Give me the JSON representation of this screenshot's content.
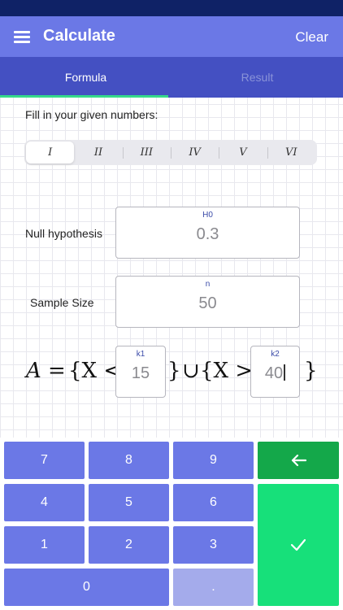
{
  "header": {
    "title": "Calculate",
    "clear_label": "Clear"
  },
  "tabs": [
    {
      "label": "Formula",
      "active": true
    },
    {
      "label": "Result",
      "active": false
    }
  ],
  "instruction": "Fill in your given numbers:",
  "segments": [
    "I",
    "II",
    "III",
    "IV",
    "V",
    "VI"
  ],
  "selected_segment": "I",
  "fields": {
    "h0": {
      "label": "Null hypothesis",
      "small_label": "H0",
      "value": "0.3"
    },
    "n": {
      "label": "Sample Size",
      "small_label": "n",
      "value": "50"
    },
    "k1": {
      "small_label": "k1",
      "value": "15"
    },
    "k2": {
      "small_label": "k2",
      "value": "40"
    }
  },
  "formula": {
    "lhs": "A",
    "equals": "=",
    "open_set_1": "{X <",
    "close_set_1": "}",
    "union": "∪",
    "open_set_2": "{X >",
    "close_set_2": "}"
  },
  "keypad": {
    "keys": [
      "7",
      "8",
      "9",
      "4",
      "5",
      "6",
      "1",
      "2",
      "3",
      "0",
      "."
    ],
    "backspace_icon": "arrow-left-icon",
    "enter_icon": "checkmark-icon"
  },
  "colors": {
    "status_bar": "#0f2266",
    "app_bar": "#6b78e6",
    "tab_bar": "#4450c2",
    "tab_indicator": "#36d98a",
    "key": "#6b78e6",
    "backspace_key": "#14a84a",
    "enter_key": "#17e07a"
  }
}
